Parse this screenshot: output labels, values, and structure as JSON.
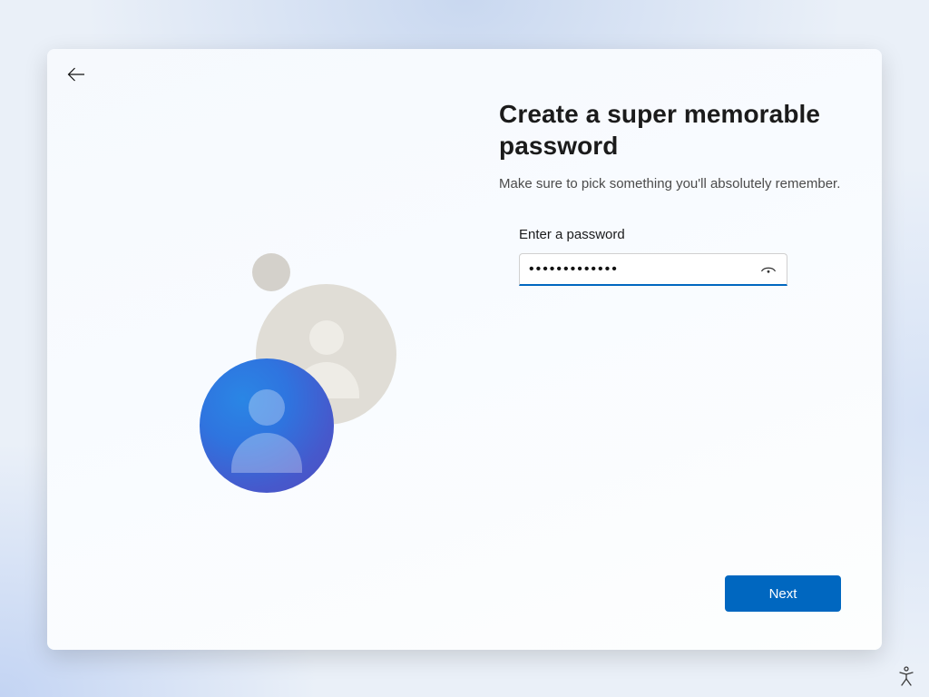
{
  "heading": "Create a super memorable password",
  "subtitle": "Make sure to pick something you'll absolutely remember.",
  "field": {
    "label": "Enter a password",
    "value": "•••••••••••••"
  },
  "buttons": {
    "next": "Next"
  },
  "icons": {
    "back": "back-arrow-icon",
    "reveal": "password-reveal-icon",
    "accessibility": "accessibility-icon",
    "avatar": "user-avatar-icon"
  }
}
